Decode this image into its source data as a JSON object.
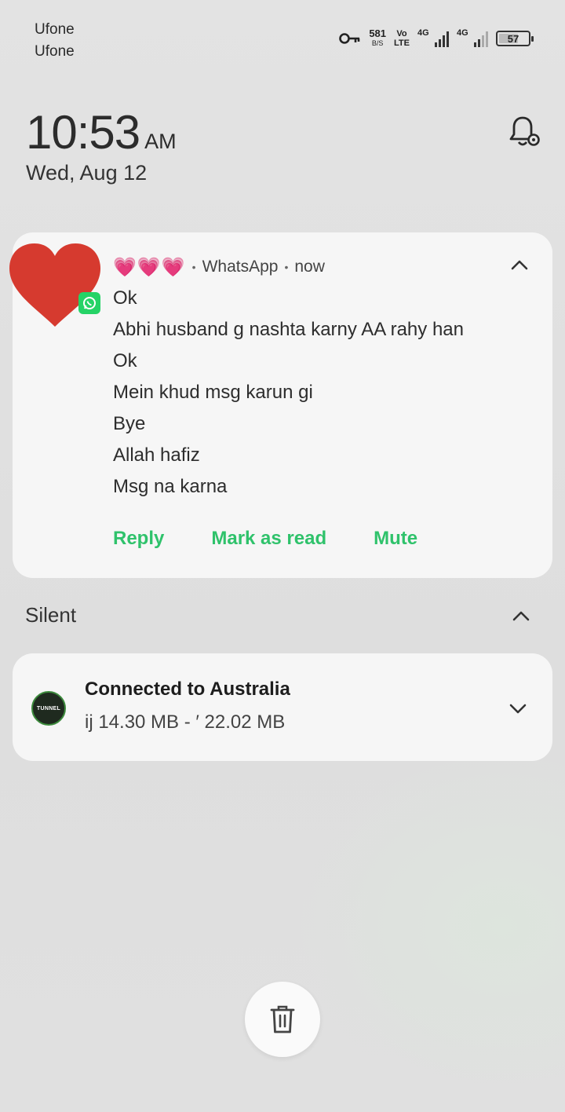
{
  "status_bar": {
    "carriers": [
      "Ufone",
      "Ufone"
    ],
    "net_speed": "581",
    "net_speed_unit": "B/S",
    "volte_top": "Vo",
    "volte_bottom": "LTE",
    "sim1_type": "4G",
    "sim2_type": "4G",
    "battery": "57",
    "icons": [
      "key-icon",
      "signal-icon",
      "battery-icon"
    ]
  },
  "lockscreen": {
    "time": "10:53",
    "ampm": "AM",
    "date": "Wed, Aug 12"
  },
  "whatsapp_notification": {
    "sender_emoji": "💗💗💗",
    "app": "WhatsApp",
    "when": "now",
    "messages": [
      "Ok",
      "Abhi husband g nashta karny AA rahy han",
      "Ok",
      "Mein khud msg karun gi",
      "Bye",
      "Allah hafiz",
      "Msg na karna"
    ],
    "actions": {
      "reply": "Reply",
      "mark_read": "Mark as read",
      "mute": "Mute"
    },
    "accent": "#2fc26b"
  },
  "silent_section": {
    "title": "Silent"
  },
  "vpn_notification": {
    "title": "Connected to Australia",
    "subtitle": "ij 14.30 MB - ′  22.02 MB",
    "icon_text": "TUNNEL"
  }
}
